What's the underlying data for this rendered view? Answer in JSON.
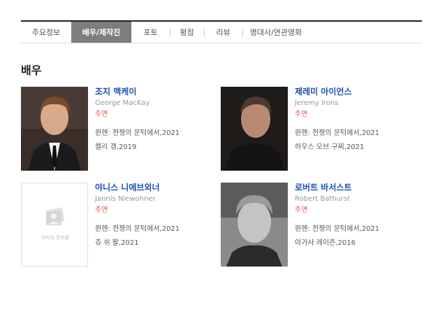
{
  "tabs": [
    {
      "label": "주요정보"
    },
    {
      "label": "배우/제작진"
    },
    {
      "label": "포토"
    },
    {
      "label": "평점"
    },
    {
      "label": "리뷰"
    },
    {
      "label": "명대사/연관영화"
    }
  ],
  "active_tab_index": 1,
  "section_title": "배우",
  "cast": [
    {
      "name": "조지 맥케이",
      "name_en": "George MacKay",
      "role": "주연",
      "works": [
        "뮌헨: 전쟁의 문턱에서,2021",
        "켈리 갱,2019"
      ],
      "photo_icon": "actor-photo"
    },
    {
      "name": "제레미 아이언스",
      "name_en": "Jeremy Irons",
      "role": "주연",
      "works": [
        "뮌헨: 전쟁의 문턱에서,2021",
        "하우스 오브 구찌,2021"
      ],
      "photo_icon": "actor-photo"
    },
    {
      "name": "야니스 니에브외너",
      "name_en": "Jannis Niewohner",
      "role": "주연",
      "works": [
        "뮌헨: 전쟁의 문턱에서,2021",
        "쥬 쉬 팔,2021"
      ],
      "photo_icon": "no-image-placeholder",
      "placeholder_text": "이미지 준비중"
    },
    {
      "name": "로버트 바서스트",
      "name_en": "Robert Bathurst",
      "role": "주연",
      "works": [
        "뮌헨: 전쟁의 문턱에서,2021",
        "아가사 레이즌,2016"
      ],
      "photo_icon": "actor-photo"
    }
  ],
  "colors": {
    "active_tab_bg": "#7d7d7d",
    "name": "#1d4fb0",
    "role": "#d9534f"
  }
}
